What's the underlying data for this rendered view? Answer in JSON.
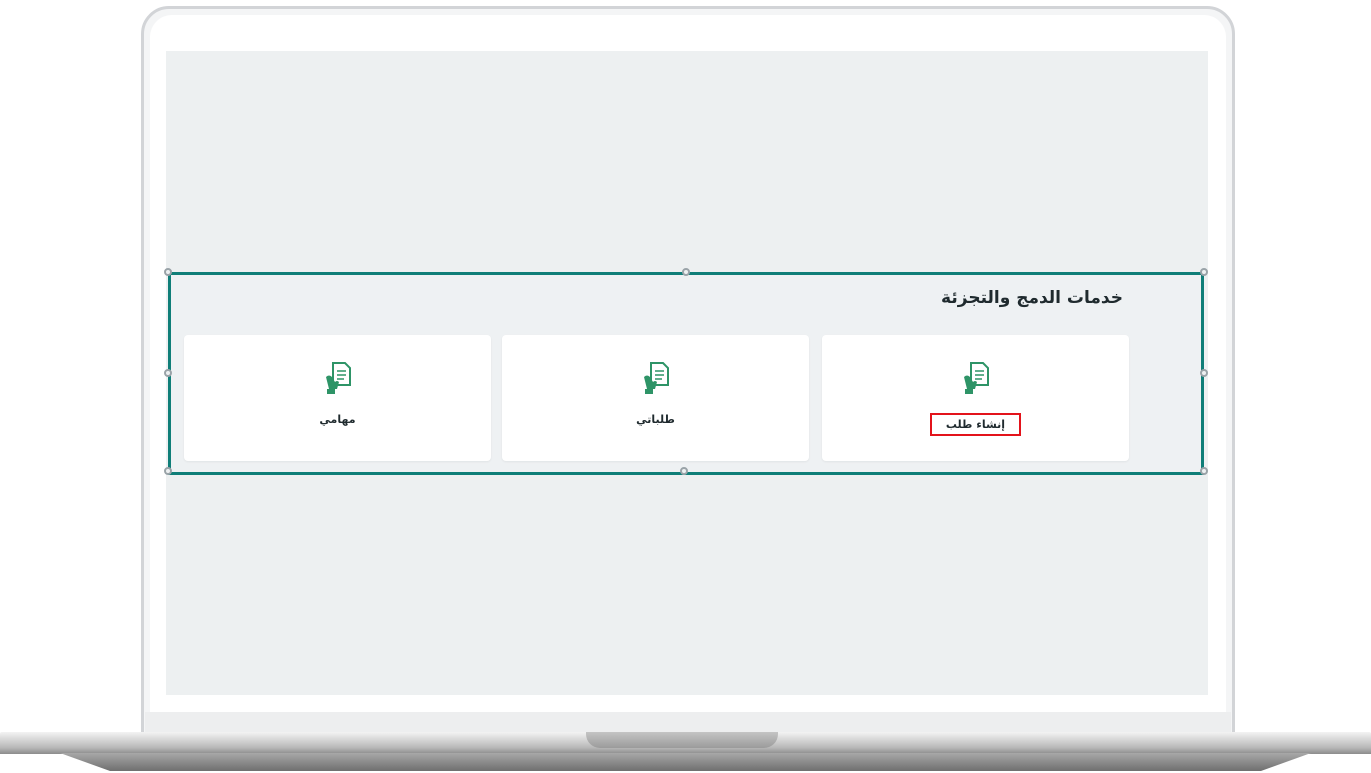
{
  "services": {
    "section_title": "خدمات الدمج والتجزئة",
    "cards": [
      {
        "label": "إنشاء طلب",
        "icon": "hand-document-icon",
        "highlighted": true
      },
      {
        "label": "طلباتي",
        "icon": "hand-document-icon",
        "highlighted": false
      },
      {
        "label": "مهامي",
        "icon": "hand-document-icon",
        "highlighted": false
      }
    ]
  },
  "colors": {
    "accent": "#0f7e78",
    "icon_green": "#2e9467",
    "highlight": "#e3131b",
    "screen_bg": "#edf0f1",
    "card_bg": "#ffffff"
  }
}
